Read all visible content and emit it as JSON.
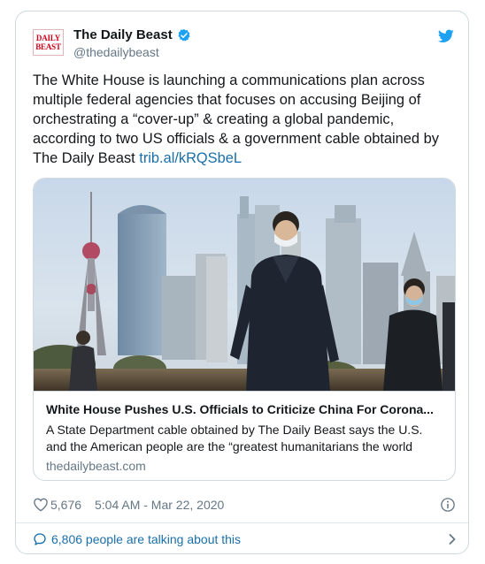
{
  "account": {
    "logo_line1": "DAILY",
    "logo_line2": "BEAST",
    "display_name": "The Daily Beast",
    "handle": "@thedailybeast"
  },
  "tweet": {
    "text": "The White House is launching a communications plan across multiple federal agencies that focuses on accusing Beijing of orchestrating a “cover-up” & creating a global pandemic, according to two US officials & a government cable obtained by The Daily Beast",
    "link": "trib.al/kRQSbeL"
  },
  "link_card": {
    "title": "White House Pushes U.S. Officials to Criticize China For Corona...",
    "description": "A State Department cable obtained by The Daily Beast says the U.S. and the American people are the “greatest humanitarians the world",
    "domain": "thedailybeast.com"
  },
  "meta": {
    "likes": "5,676",
    "timestamp": "5:04 AM - Mar 22, 2020"
  },
  "talking": {
    "text": "6,806 people are talking about this"
  },
  "colors": {
    "brand_blue": "#1da1f2",
    "link_blue": "#1b6fa8",
    "logo_red": "#d0021b",
    "secondary_text": "#657786"
  },
  "icons": [
    "verified-badge-icon",
    "twitter-bird-icon",
    "heart-icon",
    "info-icon",
    "speech-bubble-icon",
    "chevron-right-icon"
  ]
}
